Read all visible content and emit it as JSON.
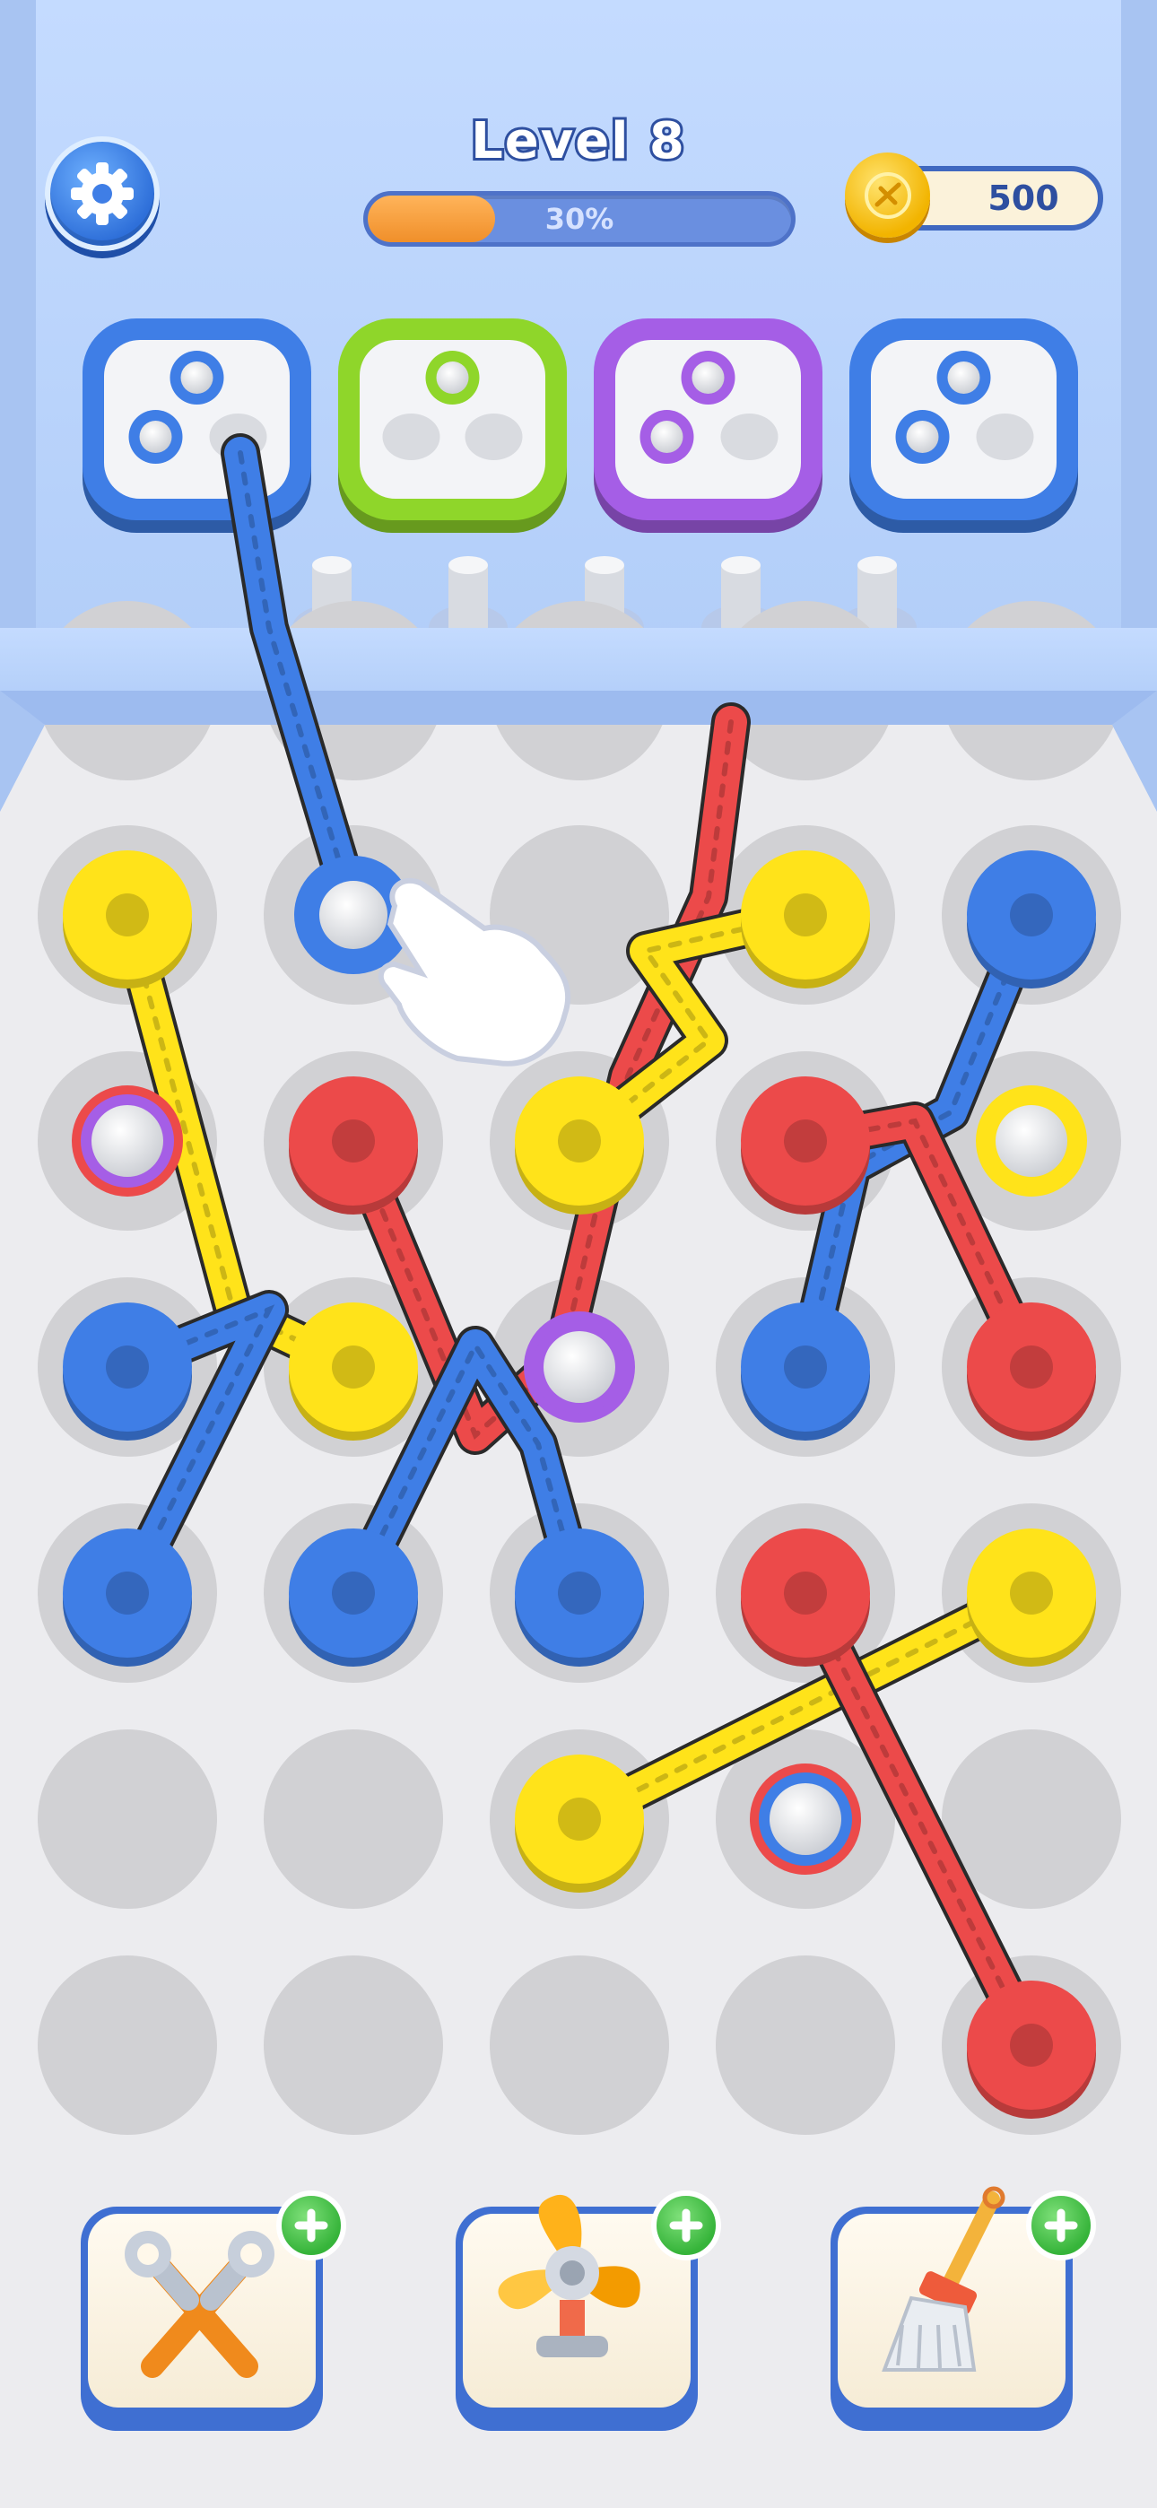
{
  "hud": {
    "level_title": "Level 8",
    "progress_text": "30%",
    "progress_value": 0.3,
    "coins": "500"
  },
  "colors": {
    "background_top": "#bcd4fa",
    "board": "#ececef",
    "hole": "#d1d1d4",
    "blue": "#3f7ee6",
    "yellow": "#ffe31a",
    "red": "#ec4a4a",
    "green": "#8fd62a",
    "purple": "#a55ee6",
    "orange": "#f39b3a"
  },
  "targets": [
    {
      "color": "blue",
      "slots_filled": 2,
      "slots_total": 3
    },
    {
      "color": "green",
      "slots_filled": 1,
      "slots_total": 3
    },
    {
      "color": "purple",
      "slots_filled": 2,
      "slots_total": 3
    },
    {
      "color": "blue",
      "slots_filled": 2,
      "slots_total": 3
    }
  ],
  "spare_pegs": 5,
  "board": {
    "rows": [
      [
        "yellow",
        "blue-selected",
        "empty",
        "yellow",
        "blue"
      ],
      [
        "red-purple-ring",
        "red",
        "yellow",
        "red",
        "yellow-ring"
      ],
      [
        "blue",
        "yellow",
        "purple-ring",
        "blue",
        "red"
      ],
      [
        "blue",
        "blue",
        "blue",
        "red",
        "yellow"
      ],
      [
        "empty",
        "empty",
        "yellow",
        "red-blue-ring",
        "empty"
      ],
      [
        "empty",
        "empty",
        "empty",
        "empty",
        "red"
      ]
    ]
  },
  "boosters": [
    {
      "name": "tools-icon"
    },
    {
      "name": "fan-icon"
    },
    {
      "name": "broom-icon"
    }
  ]
}
